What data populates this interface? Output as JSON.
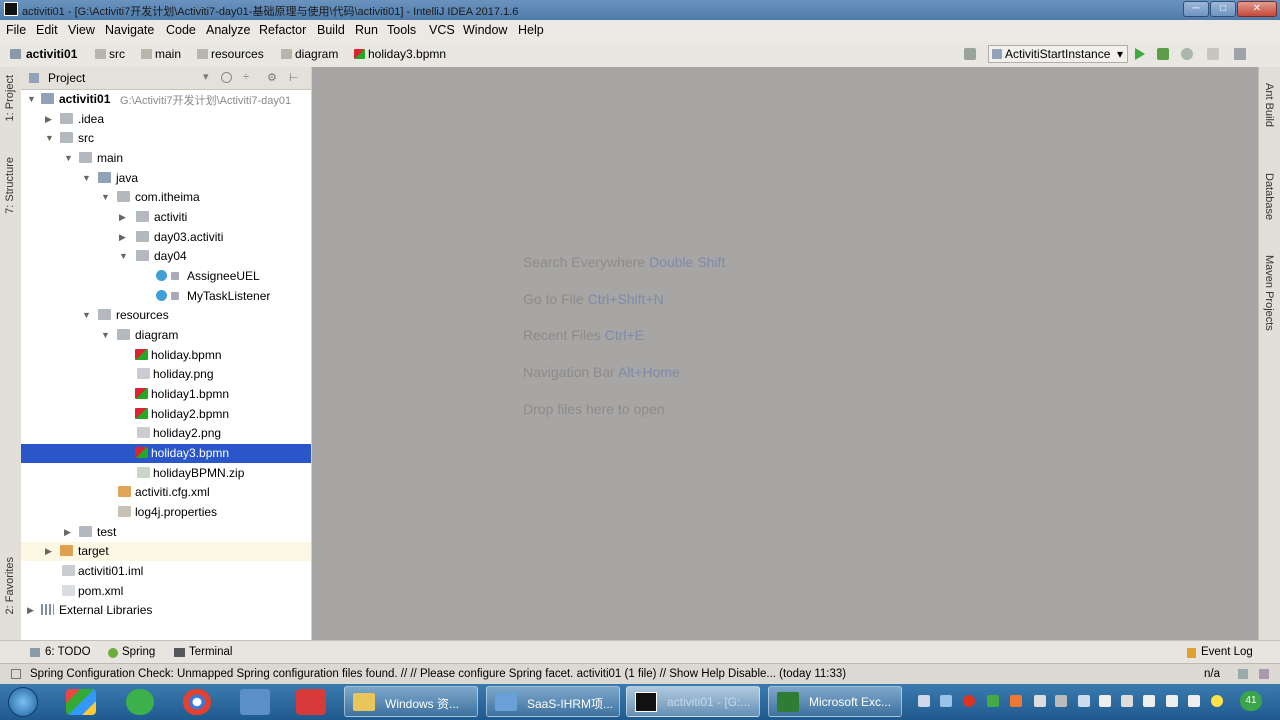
{
  "window": {
    "title": "activiti01 - [G:\\Activiti7开发计划\\Activiti7-day01-基础原理与使用\\代码\\activiti01] - IntelliJ IDEA 2017.1.6",
    "minimize_glyph": "─",
    "maximize_glyph": "□",
    "close_glyph": "✕"
  },
  "menu": [
    "File",
    "Edit",
    "View",
    "Navigate",
    "Code",
    "Analyze",
    "Refactor",
    "Build",
    "Run",
    "Tools",
    "VCS",
    "Window",
    "Help"
  ],
  "breadcrumbs": [
    "activiti01",
    "src",
    "main",
    "resources",
    "diagram",
    "holiday3.bpmn"
  ],
  "run_config": {
    "label": "ActivitiStartInstance",
    "chevron": "▾"
  },
  "left_strip": {
    "project": "1: Project",
    "structure": "7: Structure",
    "favorites": "2: Favorites"
  },
  "right_strip": {
    "ant": "Ant Build",
    "database": "Database",
    "maven": "Maven Projects"
  },
  "project_panel": {
    "header_label": "Project",
    "tree": [
      {
        "label": "activiti01",
        "extra": "G:\\Activiti7开发计划\\Activiti7-day01",
        "bold": true
      },
      {
        "label": ".idea"
      },
      {
        "label": "src"
      },
      {
        "label": "main"
      },
      {
        "label": "java"
      },
      {
        "label": "com.itheima"
      },
      {
        "label": "activiti"
      },
      {
        "label": "day03.activiti"
      },
      {
        "label": "day04"
      },
      {
        "label": "AssigneeUEL"
      },
      {
        "label": "MyTaskListener"
      },
      {
        "label": "resources"
      },
      {
        "label": "diagram"
      },
      {
        "label": "holiday.bpmn"
      },
      {
        "label": "holiday.png"
      },
      {
        "label": "holiday1.bpmn"
      },
      {
        "label": "holiday2.bpmn"
      },
      {
        "label": "holiday2.png"
      },
      {
        "label": "holiday3.bpmn"
      },
      {
        "label": "holidayBPMN.zip"
      },
      {
        "label": "activiti.cfg.xml"
      },
      {
        "label": "log4j.properties"
      },
      {
        "label": "test"
      },
      {
        "label": "target"
      },
      {
        "label": "activiti01.iml"
      },
      {
        "label": "pom.xml"
      },
      {
        "label": "External Libraries"
      }
    ]
  },
  "editor_hints": [
    {
      "text": "Search Everywhere ",
      "key": "Double Shift"
    },
    {
      "text": "Go to File ",
      "key": "Ctrl+Shift+N"
    },
    {
      "text": "Recent Files ",
      "key": "Ctrl+E"
    },
    {
      "text": "Navigation Bar ",
      "key": "Alt+Home"
    },
    {
      "text": "Drop files here to open",
      "key": ""
    }
  ],
  "bottom_tools": {
    "todo": "6: TODO",
    "spring": "Spring",
    "terminal": "Terminal",
    "event_log": "Event Log"
  },
  "status": {
    "message": "Spring Configuration Check: Unmapped Spring configuration files found. // // Please configure Spring facet. activiti01 (1 file) // Show Help Disable... (today 11:33)",
    "right": "n/a"
  },
  "taskbar": {
    "items": [
      {
        "label": "Windows 资..."
      },
      {
        "label": "SaaS-IHRM项..."
      },
      {
        "label": "activiti01 - [G:..."
      },
      {
        "label": "Microsoft Exc..."
      }
    ],
    "tray_badge": "41",
    "colors": {
      "taskbar": "#2b6aa0",
      "selection": "#2a56c9"
    }
  }
}
